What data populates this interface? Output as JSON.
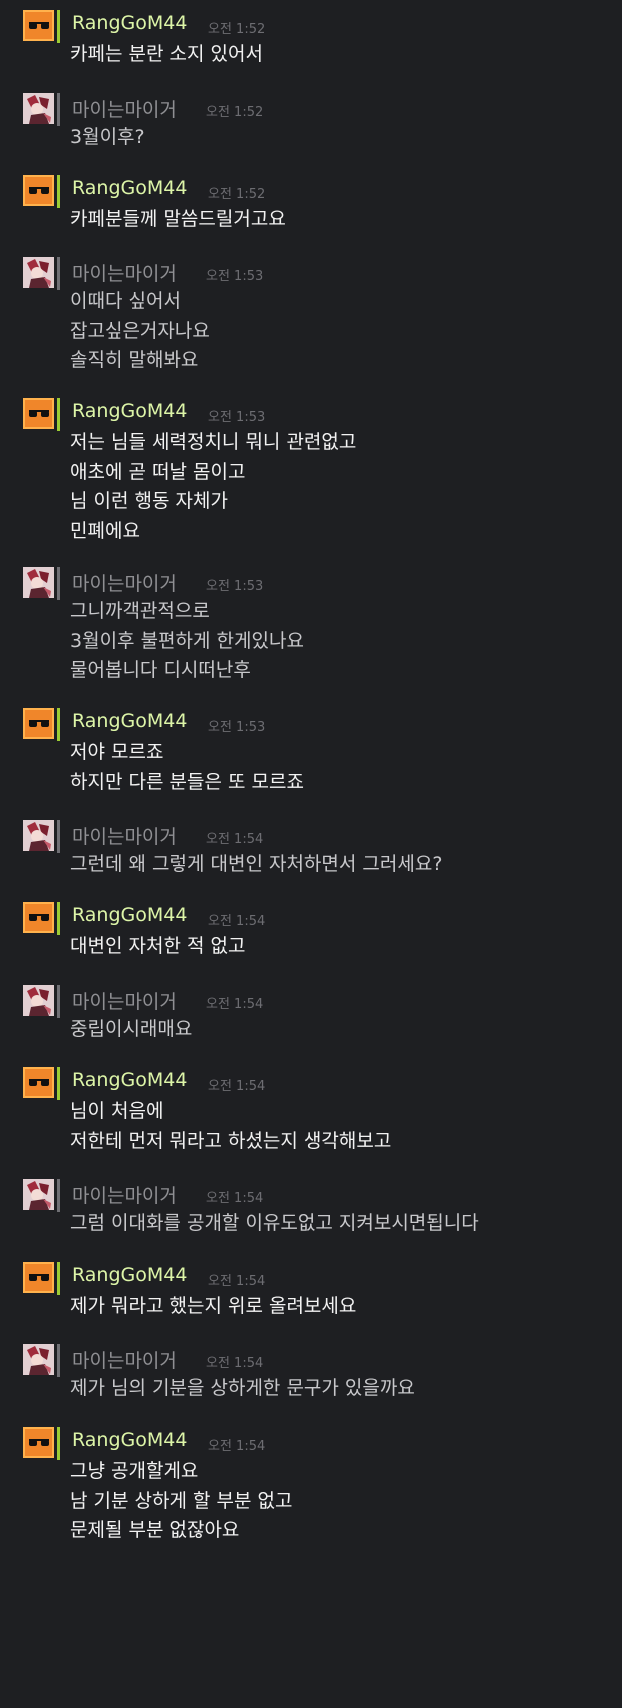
{
  "messages": [
    {
      "author": "RangGoM44",
      "time": "오전 1:52",
      "lines": [
        "카페는 분란 소지 있어서"
      ]
    },
    {
      "author": "마이는마이거",
      "time": "오전 1:52",
      "lines": [
        "3월이후?"
      ]
    },
    {
      "author": "RangGoM44",
      "time": "오전 1:52",
      "lines": [
        "카페분들께 말씀드릴거고요"
      ]
    },
    {
      "author": "마이는마이거",
      "time": "오전 1:53",
      "lines": [
        "이때다 싶어서",
        "잡고싶은거자나요",
        "솔직히 말해봐요"
      ]
    },
    {
      "author": "RangGoM44",
      "time": "오전 1:53",
      "lines": [
        "저는 님들 세력정치니 뭐니 관련없고",
        "애초에 곧 떠날 몸이고",
        "님 이런 행동 자체가",
        "민폐에요"
      ]
    },
    {
      "author": "마이는마이거",
      "time": "오전 1:53",
      "lines": [
        "그니까객관적으로",
        "3월이후 불편하게 한게있나요",
        "물어봅니다 디시떠난후"
      ]
    },
    {
      "author": "RangGoM44",
      "time": "오전 1:53",
      "lines": [
        "저야 모르죠",
        "하지만 다른 분들은 또 모르죠"
      ]
    },
    {
      "author": "마이는마이거",
      "time": "오전 1:54",
      "lines": [
        "그런데 왜 그렇게 대변인 자처하면서 그러세요?"
      ]
    },
    {
      "author": "RangGoM44",
      "time": "오전 1:54",
      "lines": [
        "대변인 자처한 적 없고"
      ]
    },
    {
      "author": "마이는마이거",
      "time": "오전 1:54",
      "lines": [
        "중립이시래매요"
      ]
    },
    {
      "author": "RangGoM44",
      "time": "오전 1:54",
      "lines": [
        "님이 처음에",
        "저한테 먼저 뭐라고 하셨는지 생각해보고"
      ]
    },
    {
      "author": "마이는마이거",
      "time": "오전 1:54",
      "lines": [
        "그럼 이대화를 공개할 이유도없고 지켜보시면됩니다"
      ]
    },
    {
      "author": "RangGoM44",
      "time": "오전 1:54",
      "lines": [
        "제가 뭐라고 했는지 위로 올려보세요"
      ]
    },
    {
      "author": "마이는마이거",
      "time": "오전 1:54",
      "lines": [
        "제가 님의 기분을 상하게한 문구가 있을까요"
      ]
    },
    {
      "author": "RangGoM44",
      "time": "오전 1:54",
      "lines": [
        "그냥 공개할게요",
        "남 기분 상하게 할 부분 없고",
        "문제될 부분 없잖아요"
      ]
    }
  ],
  "colors": {
    "background": "#1e1f22",
    "rang_name": "#ddf5a8",
    "rang_stripe": "#9ccc34",
    "mai_name": "#8f8f93",
    "timestamp": "#6d6d72"
  },
  "icons": {
    "rang_avatar": "sunglasses-avatar-icon",
    "mai_avatar": "anime-character-avatar-icon"
  }
}
